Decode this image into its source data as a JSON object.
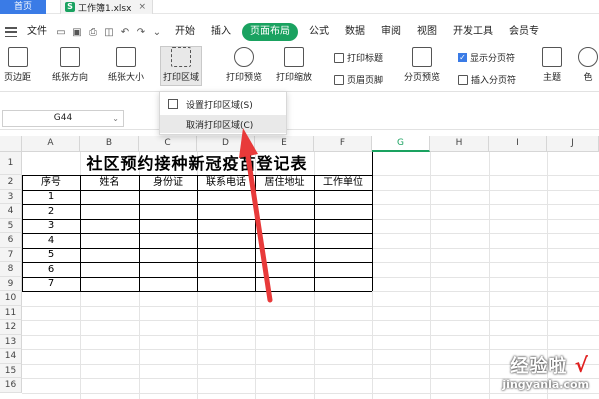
{
  "titlebar": {
    "home_tab": "首页",
    "doc_name": "工作簿1.xlsx",
    "close": "×"
  },
  "menubar": {
    "file_label": "文件",
    "tabs": [
      "开始",
      "插入",
      "页面布局",
      "公式",
      "数据",
      "审阅",
      "视图",
      "开发工具",
      "会员专"
    ],
    "active_tab": "页面布局"
  },
  "ribbon": {
    "margins": "页边距",
    "orientation": "纸张方向",
    "size": "纸张大小",
    "print_area": "打印区域",
    "print_preview": "打印预览",
    "print_scale": "打印缩放",
    "print_titles": "打印标题",
    "header_footer": "页眉页脚",
    "page_break_preview": "分页预览",
    "show_page_break": "显示分页符",
    "insert_page_break": "插入分页符",
    "theme": "主题",
    "colors": "色"
  },
  "namebox": {
    "value": "G44"
  },
  "dropdown": {
    "items": [
      "设置打印区域(S)",
      "取消打印区域(C)"
    ]
  },
  "grid": {
    "columns": [
      "A",
      "B",
      "C",
      "D",
      "E",
      "F",
      "G",
      "H",
      "I",
      "J"
    ],
    "active_column": "G",
    "rows": [
      "1",
      "2",
      "3",
      "4",
      "5",
      "6",
      "7",
      "8",
      "9",
      "10",
      "11",
      "12",
      "13",
      "14",
      "15",
      "16"
    ]
  },
  "sheet": {
    "title": "社区预约接种新冠疫苗登记表",
    "headers": [
      "序号",
      "姓名",
      "身份证",
      "联系电话",
      "居住地址",
      "工作单位"
    ],
    "serials": [
      "1",
      "2",
      "3",
      "4",
      "5",
      "6",
      "7"
    ]
  },
  "watermark": {
    "line1": "经验啦",
    "check": "√",
    "line2": "jingyanla.com"
  },
  "colors": {
    "accent_green": "#1aa260",
    "home_blue": "#3a7be6",
    "arrow_red": "#e83a3a"
  }
}
